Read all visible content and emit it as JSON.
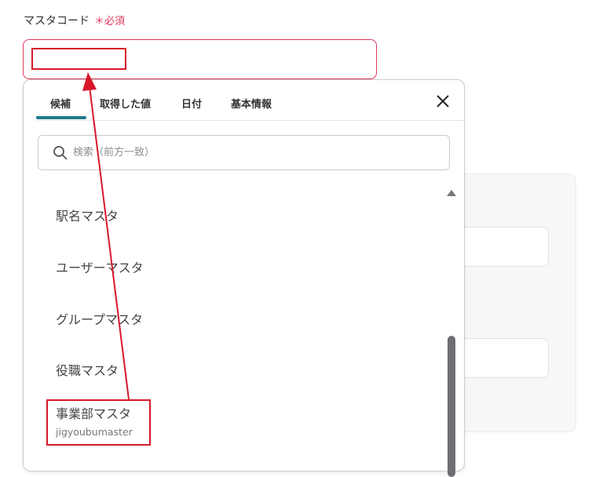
{
  "field": {
    "label": "マスタコード",
    "required": "＊必須",
    "value": ""
  },
  "popup": {
    "tabs": [
      {
        "label": "候補",
        "active": true
      },
      {
        "label": "取得した値",
        "active": false
      },
      {
        "label": "日付",
        "active": false
      },
      {
        "label": "基本情報",
        "active": false
      }
    ],
    "search_placeholder": "検索（前方一致）",
    "items": [
      {
        "label": "駅名マスタ"
      },
      {
        "label": "ユーザーマスタ"
      },
      {
        "label": "グループマスタ"
      },
      {
        "label": "役職マスタ"
      },
      {
        "label": "事業部マスタ",
        "sub": "jigyoubumaster"
      }
    ]
  },
  "colors": {
    "accent": "#1f7a8c",
    "required": "#e0385a",
    "annotation": "#d8182a"
  },
  "icons": [
    "search-icon",
    "close-icon",
    "scroll-up-icon"
  ]
}
